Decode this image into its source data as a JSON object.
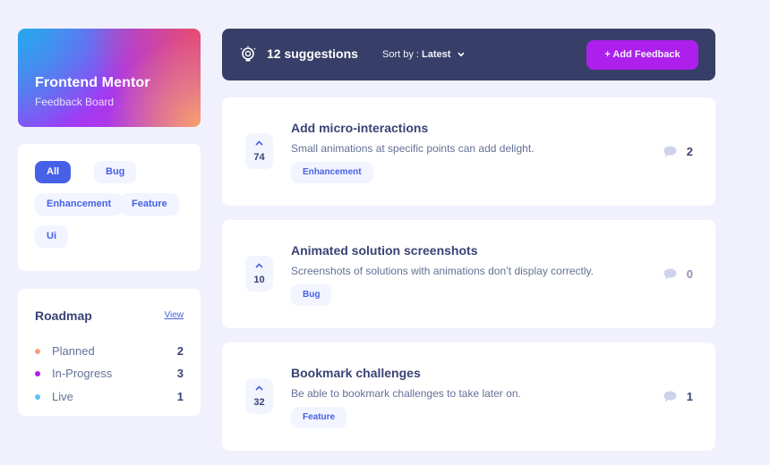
{
  "brand": {
    "title": "Frontend Mentor",
    "subtitle": "Feedback Board"
  },
  "tags": [
    {
      "label": "All",
      "active": true
    },
    {
      "label": "Bug",
      "active": false
    },
    {
      "label": "Enhancement",
      "active": false
    },
    {
      "label": "Feature",
      "active": false
    },
    {
      "label": "Ui",
      "active": false
    }
  ],
  "roadmap": {
    "title": "Roadmap",
    "view_label": "View",
    "items": [
      {
        "label": "Planned",
        "count": "2",
        "color": "#f49f85"
      },
      {
        "label": "In-Progress",
        "count": "3",
        "color": "#ad1fea"
      },
      {
        "label": "Live",
        "count": "1",
        "color": "#62bcfa"
      }
    ]
  },
  "header": {
    "count_text": "12 suggestions",
    "sort_prefix": "Sort by : ",
    "sort_value": "Latest",
    "add_button": "+ Add Feedback",
    "icon": "lightbulb-icon"
  },
  "suggestions": [
    {
      "votes": "74",
      "title": "Add micro-interactions",
      "description": "Small animations at specific points can add delight.",
      "tag": "Enhancement",
      "comments": "2"
    },
    {
      "votes": "10",
      "title": "Animated solution screenshots",
      "description": "Screenshots of solutions with animations don’t display correctly.",
      "tag": "Bug",
      "comments": "0"
    },
    {
      "votes": "32",
      "title": "Bookmark challenges",
      "description": "Be able to bookmark challenges to take later on.",
      "tag": "Feature",
      "comments": "1"
    }
  ],
  "colors": {
    "accent": "#ad1fea",
    "primary": "#4661e6",
    "header_bg": "#373f68",
    "page_bg": "#f0f1fd"
  }
}
